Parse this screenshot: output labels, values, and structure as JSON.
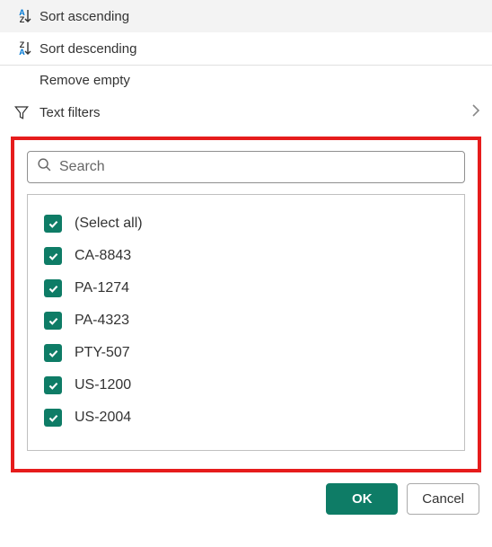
{
  "menu": {
    "sort_asc": "Sort ascending",
    "sort_desc": "Sort descending",
    "remove_empty": "Remove empty",
    "text_filters": "Text filters"
  },
  "search": {
    "placeholder": "Search"
  },
  "items": [
    {
      "label": "(Select all)",
      "checked": true
    },
    {
      "label": "CA-8843",
      "checked": true
    },
    {
      "label": "PA-1274",
      "checked": true
    },
    {
      "label": "PA-4323",
      "checked": true
    },
    {
      "label": "PTY-507",
      "checked": true
    },
    {
      "label": "US-1200",
      "checked": true
    },
    {
      "label": "US-2004",
      "checked": true
    }
  ],
  "buttons": {
    "ok": "OK",
    "cancel": "Cancel"
  }
}
